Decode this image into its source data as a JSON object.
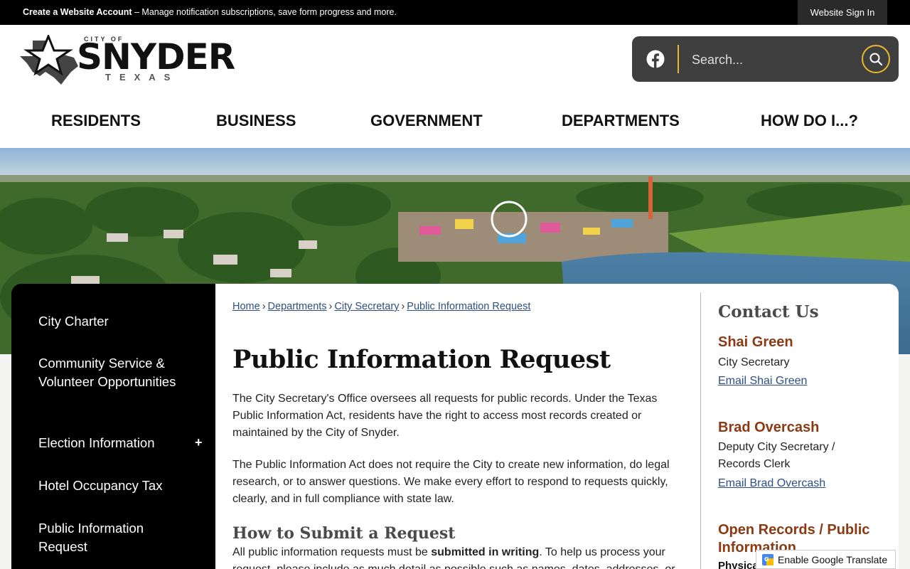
{
  "topbar": {
    "account_link": "Create a Website Account",
    "account_desc": " – Manage notification subscriptions, save form progress and more.",
    "signin": "Website Sign In"
  },
  "logo": {
    "city_of": "CITY OF",
    "name": "SNYDER",
    "state": "TEXAS"
  },
  "search": {
    "placeholder": "Search..."
  },
  "nav": [
    "RESIDENTS",
    "BUSINESS",
    "GOVERNMENT",
    "DEPARTMENTS",
    "HOW DO I...?"
  ],
  "sidebar": {
    "items": [
      "City Charter",
      "Community Service & Volunteer Opportunities",
      "Election Information",
      "Hotel Occupancy Tax",
      "Public Information Request"
    ],
    "expand": "+"
  },
  "breadcrumb": [
    "Home",
    "Departments",
    "City Secretary",
    "Public Information Request"
  ],
  "breadcrumb_sep": "›",
  "page": {
    "title": "Public Information Request",
    "p1": "The City Secretary's Office oversees all requests for public records. Under the Texas Public Information Act, residents have the right to access most records created or maintained by the City of Snyder.",
    "p2": "The Public Information Act does not require the City to create new information, do legal research, or to answer questions. We make every effort to respond to requests quickly, clearly, and in full compliance with state law.",
    "subhead": "How to Submit a Request",
    "p3_pre": "All public information requests must be ",
    "p3_bold": "submitted in writing",
    "p3_post": ". To help us process your request, please include as much detail as possible such as names, dates, addresses, or"
  },
  "contact": {
    "title": "Contact Us",
    "people": [
      {
        "name": "Shai Green",
        "role": "City Secretary",
        "email": "Email Shai Green"
      },
      {
        "name": "Brad Overcash",
        "role": "Deputy City Secretary / Records Clerk",
        "email": "Email Brad Overcash"
      }
    ],
    "section": "Open Records / Public Information",
    "physical": "Physica"
  },
  "translate": "Enable Google Translate",
  "colors": {
    "accent_gold": "#e8b92c",
    "contact_name": "#8b3a13",
    "link": "#2b4f86"
  }
}
